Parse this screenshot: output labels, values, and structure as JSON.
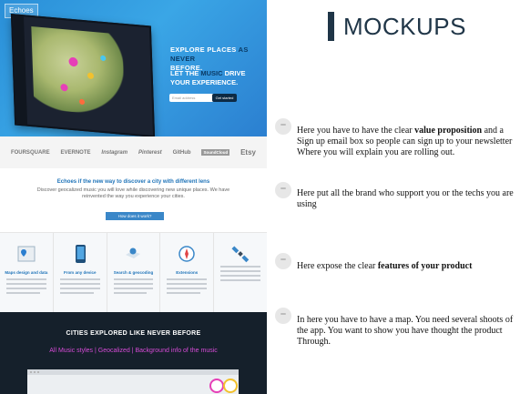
{
  "page_title": "MOCKUPS",
  "mockup": {
    "brand_tag": "Echoes",
    "hero_line1_a": "EXPLORE PLACES ",
    "hero_line1_b": "AS NEVER",
    "hero_line1_c": "BEFORE.",
    "hero_line2_a": "LET THE ",
    "hero_line2_b": "MUSIC",
    "hero_line2_c": " DRIVE YOUR EXPERIENCE.",
    "email_placeholder": "Email address",
    "email_button": "Get started",
    "logos": [
      "FOURSQUARE",
      "EVERNOTE",
      "Instagram",
      "Pinterest",
      "GitHub",
      "SoundCloud",
      "Etsy"
    ],
    "value_heading": "Echoes if the new way to discover a city with different lens",
    "value_body": "Discover geocalized music you will love while discovering new unique places. We have reinvented the way you experience your cities.",
    "how_button": "How does it work?",
    "features": [
      "Maps design and data",
      "From any device",
      "Search & geocoding",
      "Extensions",
      ""
    ],
    "cities_title": "CITIES EXPLORED LIKE NEVER BEFORE",
    "cities_sub": "All Music styles | Geocalized | Background info of the music"
  },
  "notes": [
    {
      "pre": "Here you have to have the clear ",
      "bold": "value proposition",
      "post": " and a Sign up email box so people can sign up to your newsletter Where you will explain you are rolling out."
    },
    {
      "pre": "Here put all the brand who support you or the techs you are using",
      "bold": "",
      "post": ""
    },
    {
      "pre": "Here expose the clear ",
      "bold": "features of your product",
      "post": ""
    },
    {
      "pre": "In here you have to have a map. You need several shoots of the app. You want to show you have thought the product Through.",
      "bold": "",
      "post": ""
    }
  ],
  "colors": {
    "hero": "#2a8fd8",
    "accent": "#1f3547",
    "cities_bg": "#15202b",
    "cities_accent": "#d64bd6"
  }
}
